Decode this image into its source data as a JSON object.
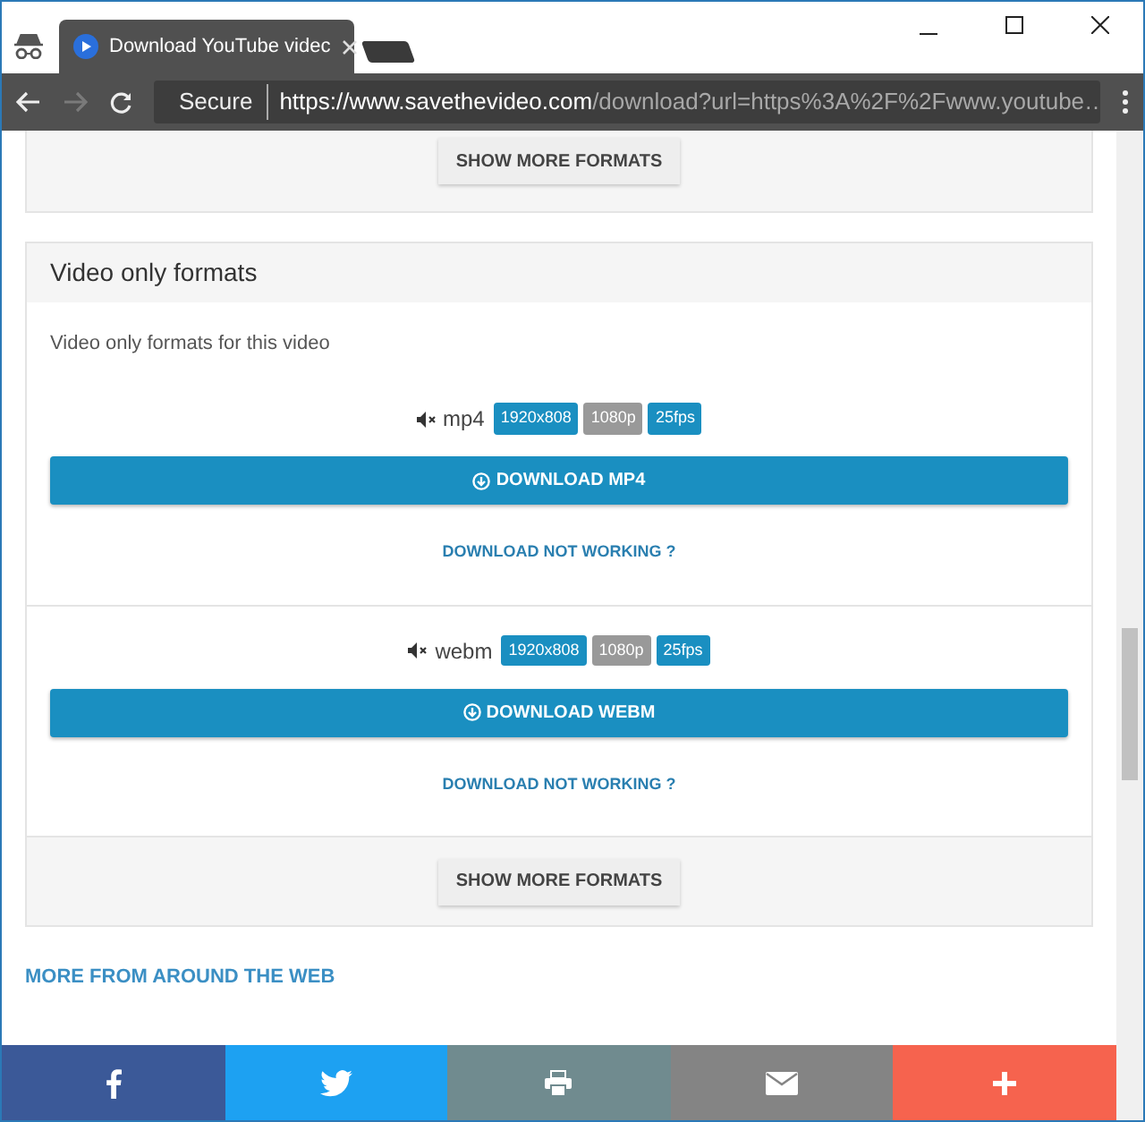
{
  "window": {
    "tab": {
      "title": "Download YouTube videc"
    },
    "address_bar": {
      "secure_label": "Secure",
      "url_host": "https://www.savethevideo.com",
      "url_path": "/download?url=https%3A%2F%2Fwww.youtube…"
    }
  },
  "top_card": {
    "button": "SHOW MORE FORMATS"
  },
  "section": {
    "title": "Video only formats",
    "description": "Video only formats for this video",
    "formats": [
      {
        "name": "mp4",
        "badges": [
          {
            "text": "1920x808",
            "color": "#1a8fc1"
          },
          {
            "text": "1080p",
            "color": "#999999"
          },
          {
            "text": "25fps",
            "color": "#1a8fc1"
          }
        ],
        "download_button": "DOWNLOAD MP4",
        "help_link": "DOWNLOAD NOT WORKING ?"
      },
      {
        "name": "webm",
        "badges": [
          {
            "text": "1920x808",
            "color": "#1a8fc1"
          },
          {
            "text": "1080p",
            "color": "#999999"
          },
          {
            "text": "25fps",
            "color": "#1a8fc1"
          }
        ],
        "download_button": "DOWNLOAD WEBM",
        "help_link": "DOWNLOAD NOT WORKING ?"
      }
    ],
    "footer_button": "SHOW MORE FORMATS"
  },
  "more_heading": "MORE FROM AROUND THE WEB",
  "share_bar": [
    {
      "kind": "facebook"
    },
    {
      "kind": "twitter"
    },
    {
      "kind": "print"
    },
    {
      "kind": "email"
    },
    {
      "kind": "more"
    }
  ]
}
